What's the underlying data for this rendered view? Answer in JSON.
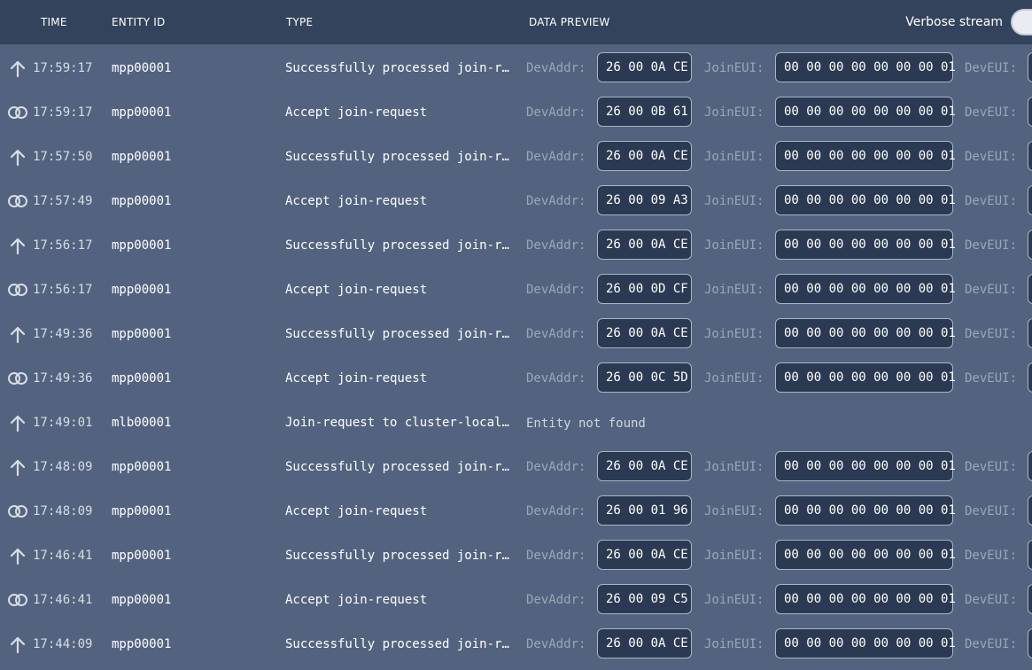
{
  "header": {
    "columns": {
      "time": "TIME",
      "entity_id": "ENTITY ID",
      "type": "TYPE",
      "data_preview": "DATA PREVIEW"
    },
    "verbose_label": "Verbose stream"
  },
  "field_labels": {
    "dev_addr": "DevAddr:",
    "join_eui": "JoinEUI:",
    "dev_eui": "DevEUI:"
  },
  "icons": {
    "uplink": "arrow-up-icon",
    "join_accept": "linked-rings-icon"
  },
  "rows": [
    {
      "icon": "up",
      "time": "17:59:17",
      "entity": "mpp00001",
      "type": "Successfully processed join-request",
      "dev_addr": "26 00 0A CE",
      "join_eui": "00 00 00 00 00 00 00 01"
    },
    {
      "icon": "join",
      "time": "17:59:17",
      "entity": "mpp00001",
      "type": "Accept join-request",
      "dev_addr": "26 00 0B 61",
      "join_eui": "00 00 00 00 00 00 00 01"
    },
    {
      "icon": "up",
      "time": "17:57:50",
      "entity": "mpp00001",
      "type": "Successfully processed join-request",
      "dev_addr": "26 00 0A CE",
      "join_eui": "00 00 00 00 00 00 00 01"
    },
    {
      "icon": "join",
      "time": "17:57:49",
      "entity": "mpp00001",
      "type": "Accept join-request",
      "dev_addr": "26 00 09 A3",
      "join_eui": "00 00 00 00 00 00 00 01"
    },
    {
      "icon": "up",
      "time": "17:56:17",
      "entity": "mpp00001",
      "type": "Successfully processed join-request",
      "dev_addr": "26 00 0A CE",
      "join_eui": "00 00 00 00 00 00 00 01"
    },
    {
      "icon": "join",
      "time": "17:56:17",
      "entity": "mpp00001",
      "type": "Accept join-request",
      "dev_addr": "26 00 0D CF",
      "join_eui": "00 00 00 00 00 00 00 01"
    },
    {
      "icon": "up",
      "time": "17:49:36",
      "entity": "mpp00001",
      "type": "Successfully processed join-request",
      "dev_addr": "26 00 0A CE",
      "join_eui": "00 00 00 00 00 00 00 01"
    },
    {
      "icon": "join",
      "time": "17:49:36",
      "entity": "mpp00001",
      "type": "Accept join-request",
      "dev_addr": "26 00 0C 5D",
      "join_eui": "00 00 00 00 00 00 00 01"
    },
    {
      "icon": "up",
      "time": "17:49:01",
      "entity": "mlb00001",
      "type": "Join-request to cluster-local Join Server failed",
      "preview_text": "Entity not found"
    },
    {
      "icon": "up",
      "time": "17:48:09",
      "entity": "mpp00001",
      "type": "Successfully processed join-request",
      "dev_addr": "26 00 0A CE",
      "join_eui": "00 00 00 00 00 00 00 01"
    },
    {
      "icon": "join",
      "time": "17:48:09",
      "entity": "mpp00001",
      "type": "Accept join-request",
      "dev_addr": "26 00 01 96",
      "join_eui": "00 00 00 00 00 00 00 01"
    },
    {
      "icon": "up",
      "time": "17:46:41",
      "entity": "mpp00001",
      "type": "Successfully processed join-request",
      "dev_addr": "26 00 0A CE",
      "join_eui": "00 00 00 00 00 00 00 01"
    },
    {
      "icon": "join",
      "time": "17:46:41",
      "entity": "mpp00001",
      "type": "Accept join-request",
      "dev_addr": "26 00 09 C5",
      "join_eui": "00 00 00 00 00 00 00 01"
    },
    {
      "icon": "up",
      "time": "17:44:09",
      "entity": "mpp00001",
      "type": "Successfully processed join-request",
      "dev_addr": "26 00 0A CE",
      "join_eui": "00 00 00 00 00 00 00 01"
    }
  ]
}
